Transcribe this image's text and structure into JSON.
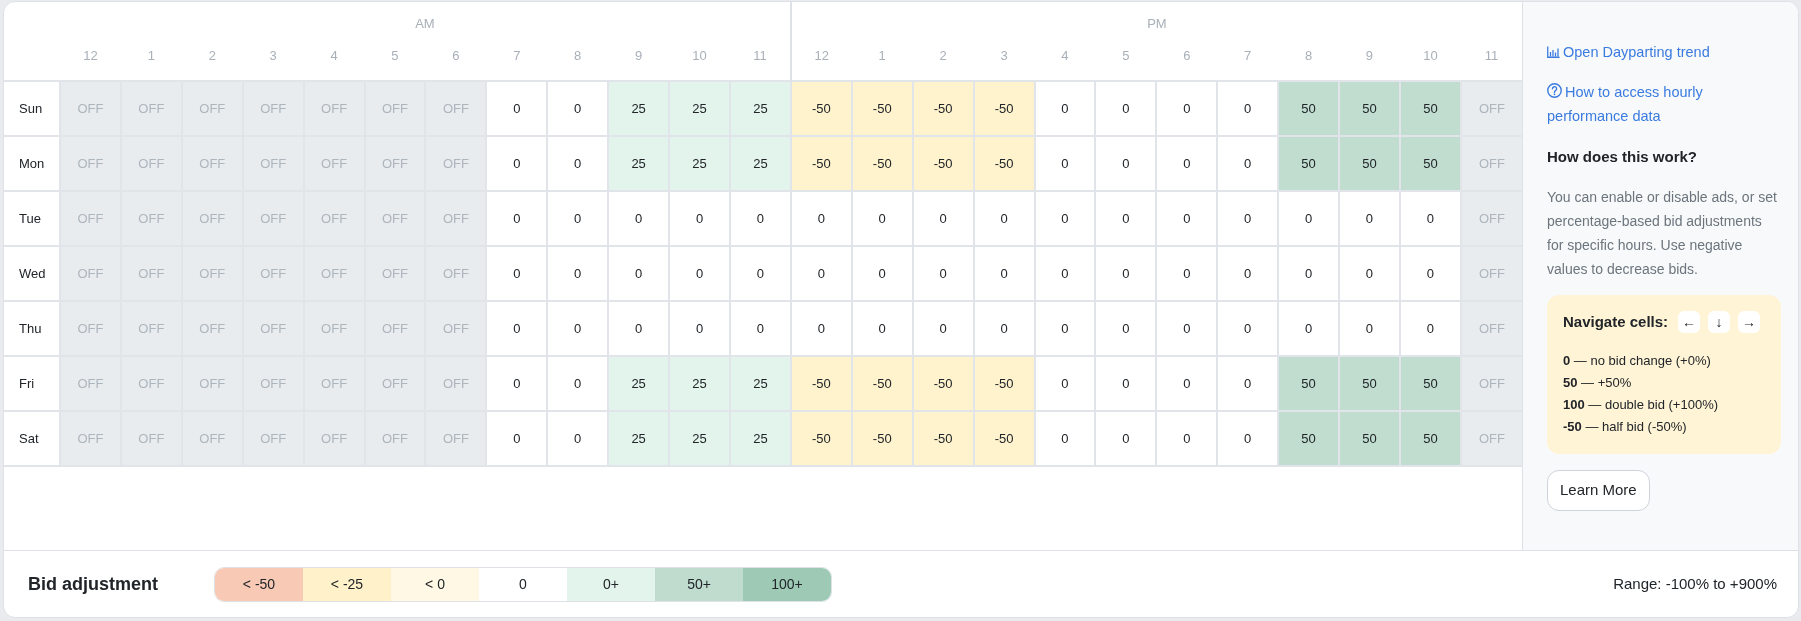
{
  "grid": {
    "periods": [
      {
        "label": "AM",
        "hours": [
          "12",
          "1",
          "2",
          "3",
          "4",
          "5",
          "6",
          "7",
          "8",
          "9",
          "10",
          "11"
        ]
      },
      {
        "label": "PM",
        "hours": [
          "12",
          "1",
          "2",
          "3",
          "4",
          "5",
          "6",
          "7",
          "8",
          "9",
          "10",
          "11"
        ]
      }
    ],
    "rows": [
      {
        "day": "Sun",
        "cells": [
          {
            "value": "OFF",
            "color": "#e9ecef",
            "disabled": true
          },
          {
            "value": "OFF",
            "color": "#e9ecef",
            "disabled": true
          },
          {
            "value": "OFF",
            "color": "#e9ecef",
            "disabled": true
          },
          {
            "value": "OFF",
            "color": "#e9ecef",
            "disabled": true
          },
          {
            "value": "OFF",
            "color": "#e9ecef",
            "disabled": true
          },
          {
            "value": "OFF",
            "color": "#e9ecef",
            "disabled": true
          },
          {
            "value": "OFF",
            "color": "#e9ecef",
            "disabled": true
          },
          {
            "value": "0",
            "color": "#ffffff",
            "disabled": false
          },
          {
            "value": "0",
            "color": "#ffffff",
            "disabled": false
          },
          {
            "value": "25",
            "color": "#e3f4ec",
            "disabled": false
          },
          {
            "value": "25",
            "color": "#e3f4ec",
            "disabled": false
          },
          {
            "value": "25",
            "color": "#e3f4ec",
            "disabled": false
          },
          {
            "value": "-50",
            "color": "#fff3cd",
            "disabled": false
          },
          {
            "value": "-50",
            "color": "#fff3cd",
            "disabled": false
          },
          {
            "value": "-50",
            "color": "#fff3cd",
            "disabled": false
          },
          {
            "value": "-50",
            "color": "#fff3cd",
            "disabled": false
          },
          {
            "value": "0",
            "color": "#ffffff",
            "disabled": false
          },
          {
            "value": "0",
            "color": "#ffffff",
            "disabled": false
          },
          {
            "value": "0",
            "color": "#ffffff",
            "disabled": false
          },
          {
            "value": "0",
            "color": "#ffffff",
            "disabled": false
          },
          {
            "value": "50",
            "color": "#c0ddd0",
            "disabled": false
          },
          {
            "value": "50",
            "color": "#c0ddd0",
            "disabled": false
          },
          {
            "value": "50",
            "color": "#c0ddd0",
            "disabled": false
          },
          {
            "value": "OFF",
            "color": "#e9ecef",
            "disabled": true
          }
        ]
      },
      {
        "day": "Mon",
        "cells": [
          {
            "value": "OFF",
            "color": "#e9ecef",
            "disabled": true
          },
          {
            "value": "OFF",
            "color": "#e9ecef",
            "disabled": true
          },
          {
            "value": "OFF",
            "color": "#e9ecef",
            "disabled": true
          },
          {
            "value": "OFF",
            "color": "#e9ecef",
            "disabled": true
          },
          {
            "value": "OFF",
            "color": "#e9ecef",
            "disabled": true
          },
          {
            "value": "OFF",
            "color": "#e9ecef",
            "disabled": true
          },
          {
            "value": "OFF",
            "color": "#e9ecef",
            "disabled": true
          },
          {
            "value": "0",
            "color": "#ffffff",
            "disabled": false
          },
          {
            "value": "0",
            "color": "#ffffff",
            "disabled": false
          },
          {
            "value": "25",
            "color": "#e3f4ec",
            "disabled": false
          },
          {
            "value": "25",
            "color": "#e3f4ec",
            "disabled": false
          },
          {
            "value": "25",
            "color": "#e3f4ec",
            "disabled": false
          },
          {
            "value": "-50",
            "color": "#fff3cd",
            "disabled": false
          },
          {
            "value": "-50",
            "color": "#fff3cd",
            "disabled": false
          },
          {
            "value": "-50",
            "color": "#fff3cd",
            "disabled": false
          },
          {
            "value": "-50",
            "color": "#fff3cd",
            "disabled": false
          },
          {
            "value": "0",
            "color": "#ffffff",
            "disabled": false
          },
          {
            "value": "0",
            "color": "#ffffff",
            "disabled": false
          },
          {
            "value": "0",
            "color": "#ffffff",
            "disabled": false
          },
          {
            "value": "0",
            "color": "#ffffff",
            "disabled": false
          },
          {
            "value": "50",
            "color": "#c0ddd0",
            "disabled": false
          },
          {
            "value": "50",
            "color": "#c0ddd0",
            "disabled": false
          },
          {
            "value": "50",
            "color": "#c0ddd0",
            "disabled": false
          },
          {
            "value": "OFF",
            "color": "#e9ecef",
            "disabled": true
          }
        ]
      },
      {
        "day": "Tue",
        "cells": [
          {
            "value": "OFF",
            "color": "#e9ecef",
            "disabled": true
          },
          {
            "value": "OFF",
            "color": "#e9ecef",
            "disabled": true
          },
          {
            "value": "OFF",
            "color": "#e9ecef",
            "disabled": true
          },
          {
            "value": "OFF",
            "color": "#e9ecef",
            "disabled": true
          },
          {
            "value": "OFF",
            "color": "#e9ecef",
            "disabled": true
          },
          {
            "value": "OFF",
            "color": "#e9ecef",
            "disabled": true
          },
          {
            "value": "OFF",
            "color": "#e9ecef",
            "disabled": true
          },
          {
            "value": "0",
            "color": "#ffffff",
            "disabled": false
          },
          {
            "value": "0",
            "color": "#ffffff",
            "disabled": false
          },
          {
            "value": "0",
            "color": "#ffffff",
            "disabled": false
          },
          {
            "value": "0",
            "color": "#ffffff",
            "disabled": false
          },
          {
            "value": "0",
            "color": "#ffffff",
            "disabled": false
          },
          {
            "value": "0",
            "color": "#ffffff",
            "disabled": false
          },
          {
            "value": "0",
            "color": "#ffffff",
            "disabled": false
          },
          {
            "value": "0",
            "color": "#ffffff",
            "disabled": false
          },
          {
            "value": "0",
            "color": "#ffffff",
            "disabled": false
          },
          {
            "value": "0",
            "color": "#ffffff",
            "disabled": false
          },
          {
            "value": "0",
            "color": "#ffffff",
            "disabled": false
          },
          {
            "value": "0",
            "color": "#ffffff",
            "disabled": false
          },
          {
            "value": "0",
            "color": "#ffffff",
            "disabled": false
          },
          {
            "value": "0",
            "color": "#ffffff",
            "disabled": false
          },
          {
            "value": "0",
            "color": "#ffffff",
            "disabled": false
          },
          {
            "value": "0",
            "color": "#ffffff",
            "disabled": false
          },
          {
            "value": "OFF",
            "color": "#e9ecef",
            "disabled": true
          }
        ]
      },
      {
        "day": "Wed",
        "cells": [
          {
            "value": "OFF",
            "color": "#e9ecef",
            "disabled": true
          },
          {
            "value": "OFF",
            "color": "#e9ecef",
            "disabled": true
          },
          {
            "value": "OFF",
            "color": "#e9ecef",
            "disabled": true
          },
          {
            "value": "OFF",
            "color": "#e9ecef",
            "disabled": true
          },
          {
            "value": "OFF",
            "color": "#e9ecef",
            "disabled": true
          },
          {
            "value": "OFF",
            "color": "#e9ecef",
            "disabled": true
          },
          {
            "value": "OFF",
            "color": "#e9ecef",
            "disabled": true
          },
          {
            "value": "0",
            "color": "#ffffff",
            "disabled": false
          },
          {
            "value": "0",
            "color": "#ffffff",
            "disabled": false
          },
          {
            "value": "0",
            "color": "#ffffff",
            "disabled": false
          },
          {
            "value": "0",
            "color": "#ffffff",
            "disabled": false
          },
          {
            "value": "0",
            "color": "#ffffff",
            "disabled": false
          },
          {
            "value": "0",
            "color": "#ffffff",
            "disabled": false
          },
          {
            "value": "0",
            "color": "#ffffff",
            "disabled": false
          },
          {
            "value": "0",
            "color": "#ffffff",
            "disabled": false
          },
          {
            "value": "0",
            "color": "#ffffff",
            "disabled": false
          },
          {
            "value": "0",
            "color": "#ffffff",
            "disabled": false
          },
          {
            "value": "0",
            "color": "#ffffff",
            "disabled": false
          },
          {
            "value": "0",
            "color": "#ffffff",
            "disabled": false
          },
          {
            "value": "0",
            "color": "#ffffff",
            "disabled": false
          },
          {
            "value": "0",
            "color": "#ffffff",
            "disabled": false
          },
          {
            "value": "0",
            "color": "#ffffff",
            "disabled": false
          },
          {
            "value": "0",
            "color": "#ffffff",
            "disabled": false
          },
          {
            "value": "OFF",
            "color": "#e9ecef",
            "disabled": true
          }
        ]
      },
      {
        "day": "Thu",
        "cells": [
          {
            "value": "OFF",
            "color": "#e9ecef",
            "disabled": true
          },
          {
            "value": "OFF",
            "color": "#e9ecef",
            "disabled": true
          },
          {
            "value": "OFF",
            "color": "#e9ecef",
            "disabled": true
          },
          {
            "value": "OFF",
            "color": "#e9ecef",
            "disabled": true
          },
          {
            "value": "OFF",
            "color": "#e9ecef",
            "disabled": true
          },
          {
            "value": "OFF",
            "color": "#e9ecef",
            "disabled": true
          },
          {
            "value": "OFF",
            "color": "#e9ecef",
            "disabled": true
          },
          {
            "value": "0",
            "color": "#ffffff",
            "disabled": false
          },
          {
            "value": "0",
            "color": "#ffffff",
            "disabled": false
          },
          {
            "value": "0",
            "color": "#ffffff",
            "disabled": false
          },
          {
            "value": "0",
            "color": "#ffffff",
            "disabled": false
          },
          {
            "value": "0",
            "color": "#ffffff",
            "disabled": false
          },
          {
            "value": "0",
            "color": "#ffffff",
            "disabled": false
          },
          {
            "value": "0",
            "color": "#ffffff",
            "disabled": false
          },
          {
            "value": "0",
            "color": "#ffffff",
            "disabled": false
          },
          {
            "value": "0",
            "color": "#ffffff",
            "disabled": false
          },
          {
            "value": "0",
            "color": "#ffffff",
            "disabled": false
          },
          {
            "value": "0",
            "color": "#ffffff",
            "disabled": false
          },
          {
            "value": "0",
            "color": "#ffffff",
            "disabled": false
          },
          {
            "value": "0",
            "color": "#ffffff",
            "disabled": false
          },
          {
            "value": "0",
            "color": "#ffffff",
            "disabled": false
          },
          {
            "value": "0",
            "color": "#ffffff",
            "disabled": false
          },
          {
            "value": "0",
            "color": "#ffffff",
            "disabled": false
          },
          {
            "value": "OFF",
            "color": "#e9ecef",
            "disabled": true
          }
        ]
      },
      {
        "day": "Fri",
        "cells": [
          {
            "value": "OFF",
            "color": "#e9ecef",
            "disabled": true
          },
          {
            "value": "OFF",
            "color": "#e9ecef",
            "disabled": true
          },
          {
            "value": "OFF",
            "color": "#e9ecef",
            "disabled": true
          },
          {
            "value": "OFF",
            "color": "#e9ecef",
            "disabled": true
          },
          {
            "value": "OFF",
            "color": "#e9ecef",
            "disabled": true
          },
          {
            "value": "OFF",
            "color": "#e9ecef",
            "disabled": true
          },
          {
            "value": "OFF",
            "color": "#e9ecef",
            "disabled": true
          },
          {
            "value": "0",
            "color": "#ffffff",
            "disabled": false
          },
          {
            "value": "0",
            "color": "#ffffff",
            "disabled": false
          },
          {
            "value": "25",
            "color": "#e3f4ec",
            "disabled": false
          },
          {
            "value": "25",
            "color": "#e3f4ec",
            "disabled": false
          },
          {
            "value": "25",
            "color": "#e3f4ec",
            "disabled": false
          },
          {
            "value": "-50",
            "color": "#fff3cd",
            "disabled": false
          },
          {
            "value": "-50",
            "color": "#fff3cd",
            "disabled": false
          },
          {
            "value": "-50",
            "color": "#fff3cd",
            "disabled": false
          },
          {
            "value": "-50",
            "color": "#fff3cd",
            "disabled": false
          },
          {
            "value": "0",
            "color": "#ffffff",
            "disabled": false
          },
          {
            "value": "0",
            "color": "#ffffff",
            "disabled": false
          },
          {
            "value": "0",
            "color": "#ffffff",
            "disabled": false
          },
          {
            "value": "0",
            "color": "#ffffff",
            "disabled": false
          },
          {
            "value": "50",
            "color": "#c0ddd0",
            "disabled": false
          },
          {
            "value": "50",
            "color": "#c0ddd0",
            "disabled": false
          },
          {
            "value": "50",
            "color": "#c0ddd0",
            "disabled": false
          },
          {
            "value": "OFF",
            "color": "#e9ecef",
            "disabled": true
          }
        ]
      },
      {
        "day": "Sat",
        "cells": [
          {
            "value": "OFF",
            "color": "#e9ecef",
            "disabled": true
          },
          {
            "value": "OFF",
            "color": "#e9ecef",
            "disabled": true
          },
          {
            "value": "OFF",
            "color": "#e9ecef",
            "disabled": true
          },
          {
            "value": "OFF",
            "color": "#e9ecef",
            "disabled": true
          },
          {
            "value": "OFF",
            "color": "#e9ecef",
            "disabled": true
          },
          {
            "value": "OFF",
            "color": "#e9ecef",
            "disabled": true
          },
          {
            "value": "OFF",
            "color": "#e9ecef",
            "disabled": true
          },
          {
            "value": "0",
            "color": "#ffffff",
            "disabled": false
          },
          {
            "value": "0",
            "color": "#ffffff",
            "disabled": false
          },
          {
            "value": "25",
            "color": "#e3f4ec",
            "disabled": false
          },
          {
            "value": "25",
            "color": "#e3f4ec",
            "disabled": false
          },
          {
            "value": "25",
            "color": "#e3f4ec",
            "disabled": false
          },
          {
            "value": "-50",
            "color": "#fff3cd",
            "disabled": false
          },
          {
            "value": "-50",
            "color": "#fff3cd",
            "disabled": false
          },
          {
            "value": "-50",
            "color": "#fff3cd",
            "disabled": false
          },
          {
            "value": "-50",
            "color": "#fff3cd",
            "disabled": false
          },
          {
            "value": "0",
            "color": "#ffffff",
            "disabled": false
          },
          {
            "value": "0",
            "color": "#ffffff",
            "disabled": false
          },
          {
            "value": "0",
            "color": "#ffffff",
            "disabled": false
          },
          {
            "value": "0",
            "color": "#ffffff",
            "disabled": false
          },
          {
            "value": "50",
            "color": "#c0ddd0",
            "disabled": false
          },
          {
            "value": "50",
            "color": "#c0ddd0",
            "disabled": false
          },
          {
            "value": "50",
            "color": "#c0ddd0",
            "disabled": false
          },
          {
            "value": "OFF",
            "color": "#e9ecef",
            "disabled": true
          }
        ]
      }
    ]
  },
  "side_panel": {
    "links": [
      {
        "kind": "trend",
        "text": "Open Dayparting trend"
      },
      {
        "kind": "help",
        "text": "How to access hourly performance data"
      }
    ],
    "heading": "How does this work?",
    "description": "You can enable or disable ads, or set percentage-based bid adjustments for specific hours. Use negative values to decrease bids.",
    "tip": {
      "title": "Navigate cells:",
      "keys": [
        "←",
        "↓",
        "→"
      ],
      "lines": [
        "**0** — no bid change (+0%)",
        "**50** — +50%",
        "**100** — double bid (+100%)",
        "**-50** — half bid (-50%)"
      ]
    },
    "button": "Learn More"
  },
  "legend": {
    "title": "Bid adjustment",
    "bins": [
      {
        "label": "< -50",
        "color": "#f8c9b4"
      },
      {
        "label": "< -25",
        "color": "#fff1c9"
      },
      {
        "label": "< 0",
        "color": "#fff8e5"
      },
      {
        "label": "0",
        "color": "#ffffff"
      },
      {
        "label": "0+",
        "color": "#e3f4ec"
      },
      {
        "label": "50+",
        "color": "#bfdccf"
      },
      {
        "label": "100+",
        "color": "#9ecab5"
      }
    ],
    "range": "Range: -100% to +900%"
  }
}
